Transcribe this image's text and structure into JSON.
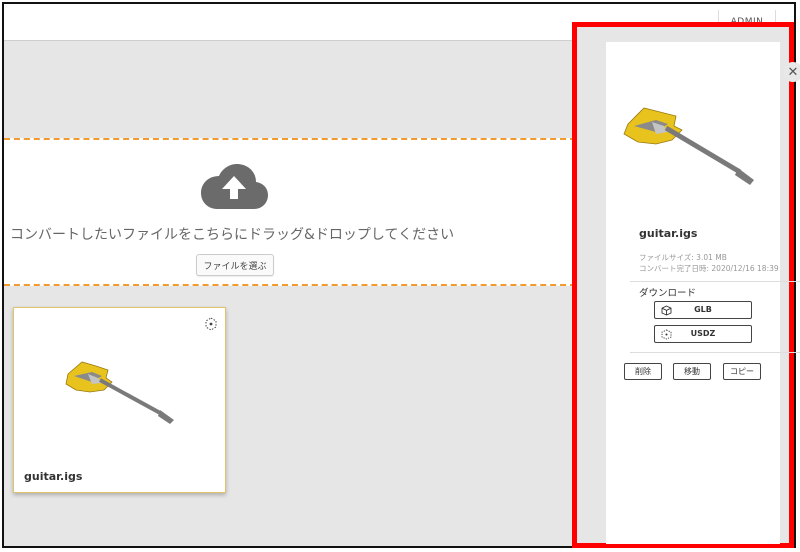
{
  "header": {
    "admin_label": "ADMIN"
  },
  "dropzone": {
    "instruction": "コンバートしたいファイルをこちらにドラッグ&ドロップしてください",
    "choose_file_label": "ファイルを選ぶ",
    "icon": "cloud-upload-icon",
    "border_color": "#f29a2e"
  },
  "files": [
    {
      "name": "guitar.igs",
      "thumbnail": "guitar-thumbnail",
      "icon": "3d-rotate-icon"
    }
  ],
  "detail_panel": {
    "close_icon": "close-icon",
    "file_name": "guitar.igs",
    "file_size_text": "ファイルサイズ: 3.01 MB",
    "converted_text": "コンバート完了日時: 2020/12/16 18:39",
    "download_label": "ダウンロード",
    "downloads": [
      {
        "label": "GLB",
        "icon": "cube-icon"
      },
      {
        "label": "USDZ",
        "icon": "dotted-cube-icon"
      }
    ],
    "actions": [
      {
        "label": "削除"
      },
      {
        "label": "移動"
      },
      {
        "label": "コピー"
      }
    ],
    "highlight_color": "#ff0000"
  }
}
